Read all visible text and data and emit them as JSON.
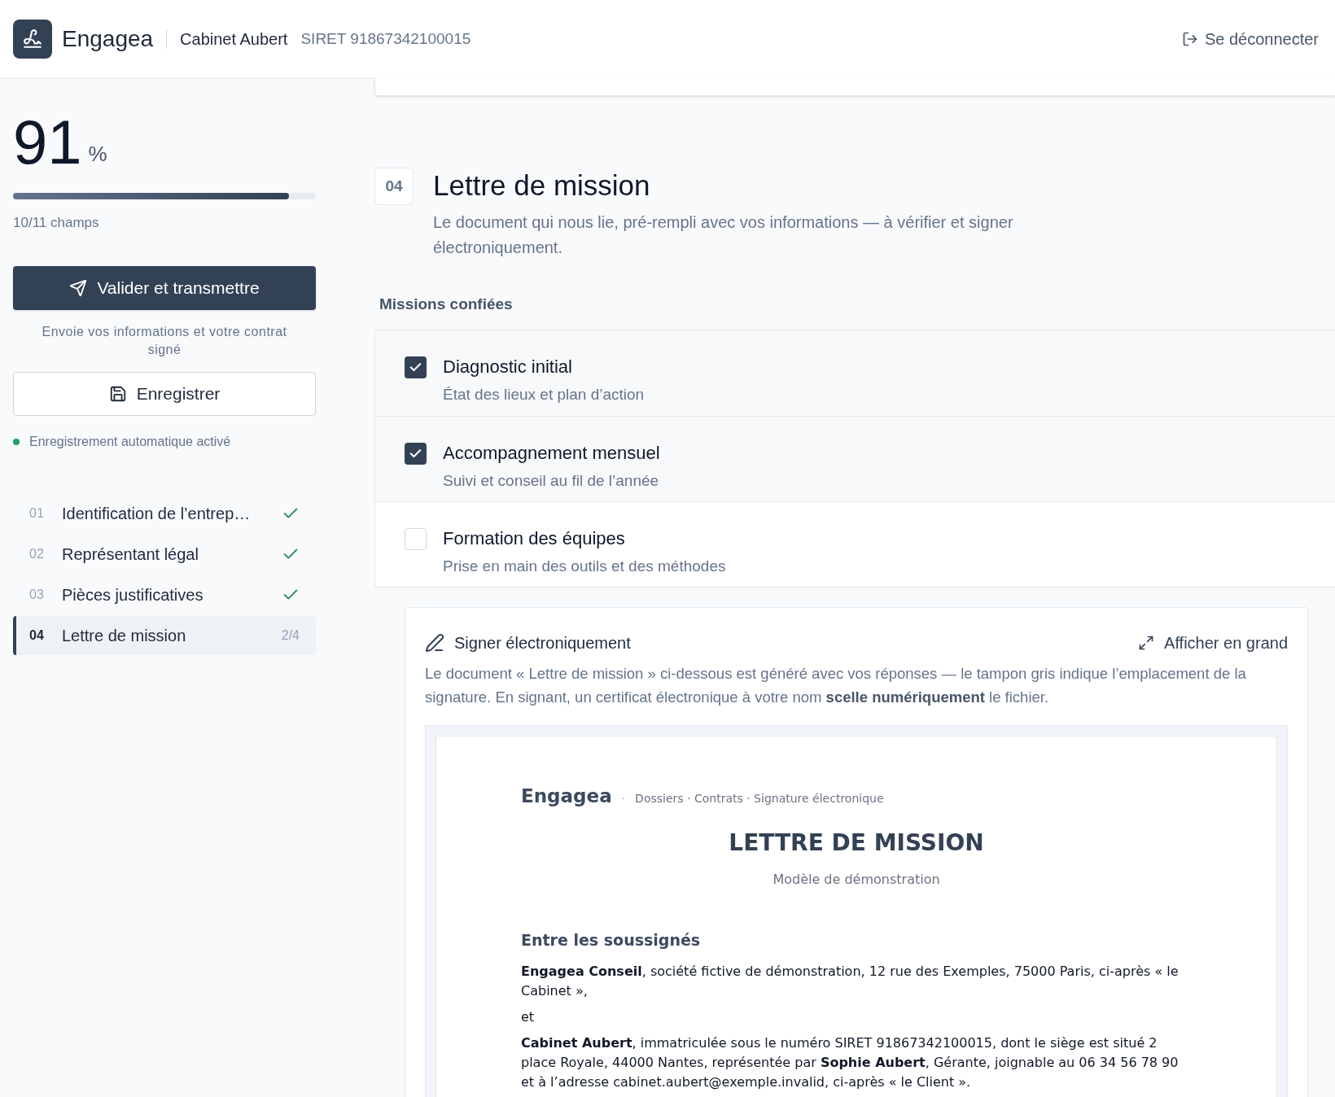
{
  "header": {
    "brand": "Engagea",
    "company": "Cabinet Aubert",
    "siret": "SIRET 91867342100015",
    "logout": "Se déconnecter"
  },
  "sidebar": {
    "percent": "91",
    "percent_sign": "%",
    "progress": {
      "level": 0.91
    },
    "fields": "10/11 champs",
    "submit": "Valider et transmettre",
    "submit_hint": "Envoie vos informations et votre contrat signé",
    "save": "Enregistrer",
    "autosave": {
      "label": "Enregistrement automatique activé",
      "on": true
    },
    "steps": [
      {
        "number": "01",
        "label": "Identification de l’entrep…",
        "done": true,
        "selected": false
      },
      {
        "number": "02",
        "label": "Représentant légal",
        "done": true,
        "selected": false
      },
      {
        "number": "03",
        "label": "Pièces justificatives",
        "done": true,
        "selected": false
      },
      {
        "number": "04",
        "label": "Lettre de mission",
        "count": "2/4",
        "done": false,
        "selected": true
      }
    ]
  },
  "section": {
    "number": "04",
    "title": "Lettre de mission",
    "description": "Le document qui nous lie, pré-rempli avec vos informations — à vérifier et signer électroniquement.",
    "missions_label": "Missions confiées",
    "missions": [
      {
        "title": "Diagnostic initial",
        "subtitle": "État des lieux et plan d’action",
        "checked": true
      },
      {
        "title": "Accompagnement mensuel",
        "subtitle": "Suivi et conseil au fil de l’année",
        "checked": true
      },
      {
        "title": "Formation des équipes",
        "subtitle": "Prise en main des outils et des méthodes",
        "checked": false
      }
    ]
  },
  "signing": {
    "title": "Signer électroniquement",
    "expand": "Afficher en grand",
    "description": "Le document « Lettre de mission » ci-dessous est généré avec vos réponses — le tampon gris indique l’emplacement de la signature. En signant, un certificat électronique à votre nom **scelle numériquement** le fichier.",
    "document": {
      "brand": "Engagea",
      "separator": "·",
      "breadcrumb": "Dossiers · Contrats · Signature électronique",
      "title": "LETTRE DE MISSION",
      "subtitle": "Modèle de démonstration",
      "heading": "Entre les soussignés",
      "paragraphs": [
        "**Engagea Conseil**, société fictive de démonstration, 12 rue des Exemples, 75000 Paris, ci-après « le Cabinet »,",
        "et",
        "**Cabinet Aubert**, immatriculée sous le numéro SIRET 91867342100015, dont le siège est situé 2 place Royale, 44000 Nantes, représentée par **Sophie Aubert**, Gérante, joignable au 06 34 56 78 90 et à l’adresse cabinet.aubert@exemple.invalid, ci-après « le Client »."
      ]
    }
  }
}
